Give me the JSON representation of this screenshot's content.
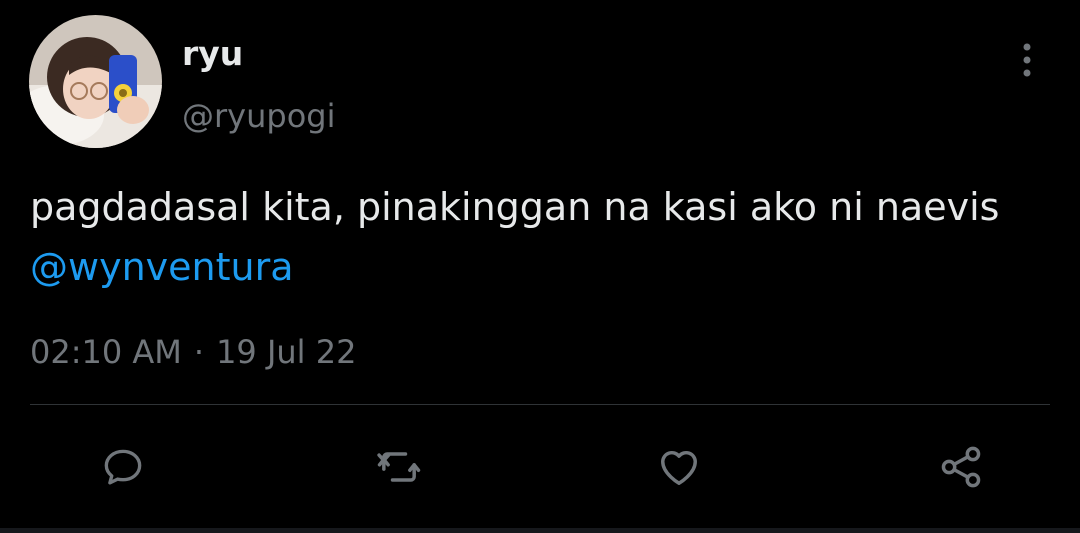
{
  "author": {
    "display_name": "ryu",
    "handle": "@ryupogi",
    "avatar": "profile-photo"
  },
  "tweet": {
    "text_before": "pagdadasal kita, pinakinggan na kasi ako ni naevis",
    "mention": "@wynventura",
    "time": "02:10 AM",
    "separator": "·",
    "date": "19 Jul 22"
  },
  "actions": [
    {
      "name": "reply",
      "icon": "speech-bubble-icon"
    },
    {
      "name": "retweet",
      "icon": "retweet-arrows-icon"
    },
    {
      "name": "like",
      "icon": "heart-icon"
    },
    {
      "name": "share",
      "icon": "share-nodes-icon"
    }
  ],
  "colors": {
    "background": "#000000",
    "text": "#e7e9ea",
    "secondary_text": "#71767b",
    "link": "#1d9bf0",
    "divider": "#2f3336"
  }
}
